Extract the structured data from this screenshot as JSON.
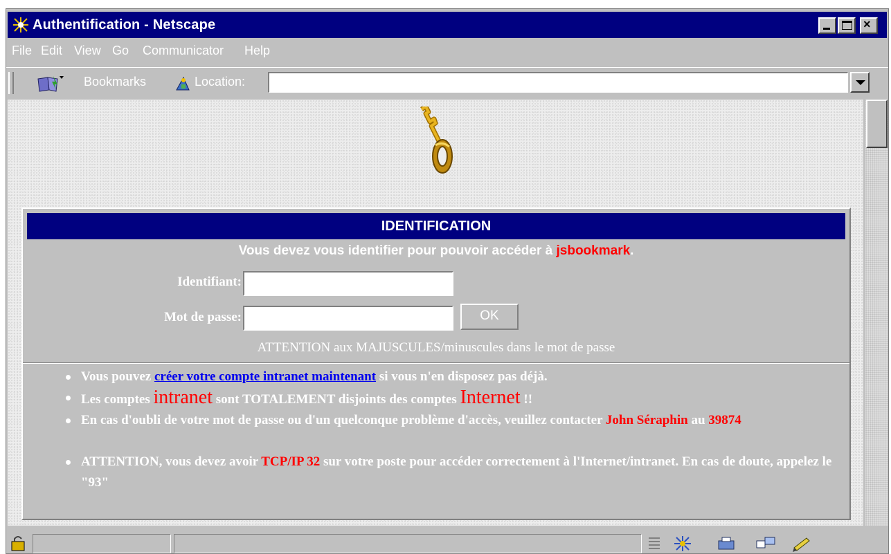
{
  "window": {
    "title": "Authentification - Netscape"
  },
  "menubar": {
    "items": [
      {
        "label": "File"
      },
      {
        "label": "Edit"
      },
      {
        "label": "View"
      },
      {
        "label": "Go"
      },
      {
        "label": "Communicator"
      },
      {
        "label": "Help"
      }
    ]
  },
  "toolbar": {
    "bookmarks_label": "Bookmarks",
    "location_label": "Location:",
    "location_value": ""
  },
  "panel": {
    "heading": "IDENTIFICATION",
    "intro_text": "Vous devez vous identifier pour pouvoir accéder à ",
    "app_name": "jsbookmark",
    "intro_end": ".",
    "login_label": "Identifiant:",
    "password_label": "Mot de passe:",
    "ok_label": "OK",
    "warning": "ATTENTION aux MAJUSCULES/minuscules dans le mot de passe"
  },
  "bullets": {
    "b1_pre": "Vous pouvez ",
    "b1_link": "créer votre compte intranet maintenant",
    "b1_post": " si vous n'en disposez pas déjà.",
    "b2_pre": "Les comptes ",
    "b2_word1": "intranet",
    "b2_mid": " sont TOTALEMENT disjoints des comptes ",
    "b2_word2": "Internet",
    "b2_post": " !!",
    "b3_pre": "En cas d'oubli de votre mot de passe ou d'un quelconque problème d'accès, veuillez contacter ",
    "b3_name": "John Séraphin",
    "b3_mid": " au ",
    "b3_number": "39874",
    "b4_pre": "ATTENTION, vous devez avoir ",
    "b4_tcp": "TCP/IP 32",
    "b4_post": " sur votre poste pour accéder correctement à l'Internet/intranet. En cas de doute, appelez le \"93\""
  },
  "icons": {
    "app": "netscape-icon",
    "bookmarks": "bookmarks-icon",
    "location": "location-icon",
    "key": "key-icon",
    "security": "lock-icon"
  },
  "colors": {
    "titlebar": "#000080",
    "accent_red": "#ff0000",
    "link": "#0000ee",
    "chrome": "#c0c0c0"
  }
}
